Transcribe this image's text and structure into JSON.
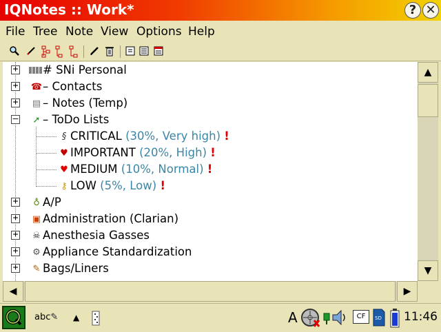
{
  "window": {
    "title": "IQNotes :: Work*",
    "help_label": "?",
    "close_label": "✕"
  },
  "menu": [
    "File",
    "Tree",
    "Note",
    "View",
    "Options",
    "Help"
  ],
  "toolbar": {
    "icons": [
      "search-icon",
      "edit-icon",
      "tree-branch-icon",
      "tree-child-icon",
      "tree-sibling-icon",
      "pencil-icon",
      "trash-icon",
      "notes-icon",
      "note-text-icon",
      "note-list-icon"
    ]
  },
  "tree": {
    "items": [
      {
        "label": "SNi Personal",
        "prefix": "# ",
        "icon": "barcode-icon",
        "glyph": "▥",
        "expander": "+"
      },
      {
        "label": "Contacts",
        "prefix": "– ",
        "icon": "phone-icon",
        "glyph": "☎",
        "expander": "+"
      },
      {
        "label": "Notes (Temp)",
        "prefix": "– ",
        "icon": "notebook-icon",
        "glyph": "▤",
        "expander": "+"
      },
      {
        "label": "ToDo Lists",
        "prefix": "– ",
        "icon": "arrow-icon",
        "glyph": "➚",
        "expander": "–",
        "children": [
          {
            "label": "CRITICAL",
            "detail": "(30%, Very high)",
            "flag": "!",
            "icon": "critical-icon",
            "glyph": "§"
          },
          {
            "label": "IMPORTANT",
            "detail": "(20%, High)",
            "flag": "!",
            "icon": "broken-heart-icon",
            "glyph": "♥"
          },
          {
            "label": "MEDIUM",
            "detail": "(10%, Normal)",
            "flag": "!",
            "icon": "heart-icon",
            "glyph": "♥"
          },
          {
            "label": "LOW",
            "detail": "(5%, Low)",
            "flag": "!",
            "icon": "key-icon",
            "glyph": "⚷"
          }
        ]
      },
      {
        "label": "A/P",
        "prefix": "",
        "icon": "bulb-icon",
        "glyph": "♁",
        "expander": "+"
      },
      {
        "label": "Administration (Clarian)",
        "prefix": "",
        "icon": "badge-icon",
        "glyph": "▣",
        "expander": "+"
      },
      {
        "label": "Anesthesia Gasses",
        "prefix": "",
        "icon": "skull-icon",
        "glyph": "☠",
        "expander": "+"
      },
      {
        "label": "Appliance Standardization",
        "prefix": "",
        "icon": "appliance-icon",
        "glyph": "⚙",
        "expander": "+"
      },
      {
        "label": "Bags/Liners",
        "prefix": "",
        "icon": "brush-icon",
        "glyph": "✎",
        "expander": "+"
      }
    ]
  },
  "taskbar": {
    "clock": "11:46",
    "input_label": "abc",
    "keyboard_glyph": "A",
    "cf_label": "CF"
  },
  "colors": {
    "detail": "#3b86a6",
    "flag": "#e00000"
  }
}
